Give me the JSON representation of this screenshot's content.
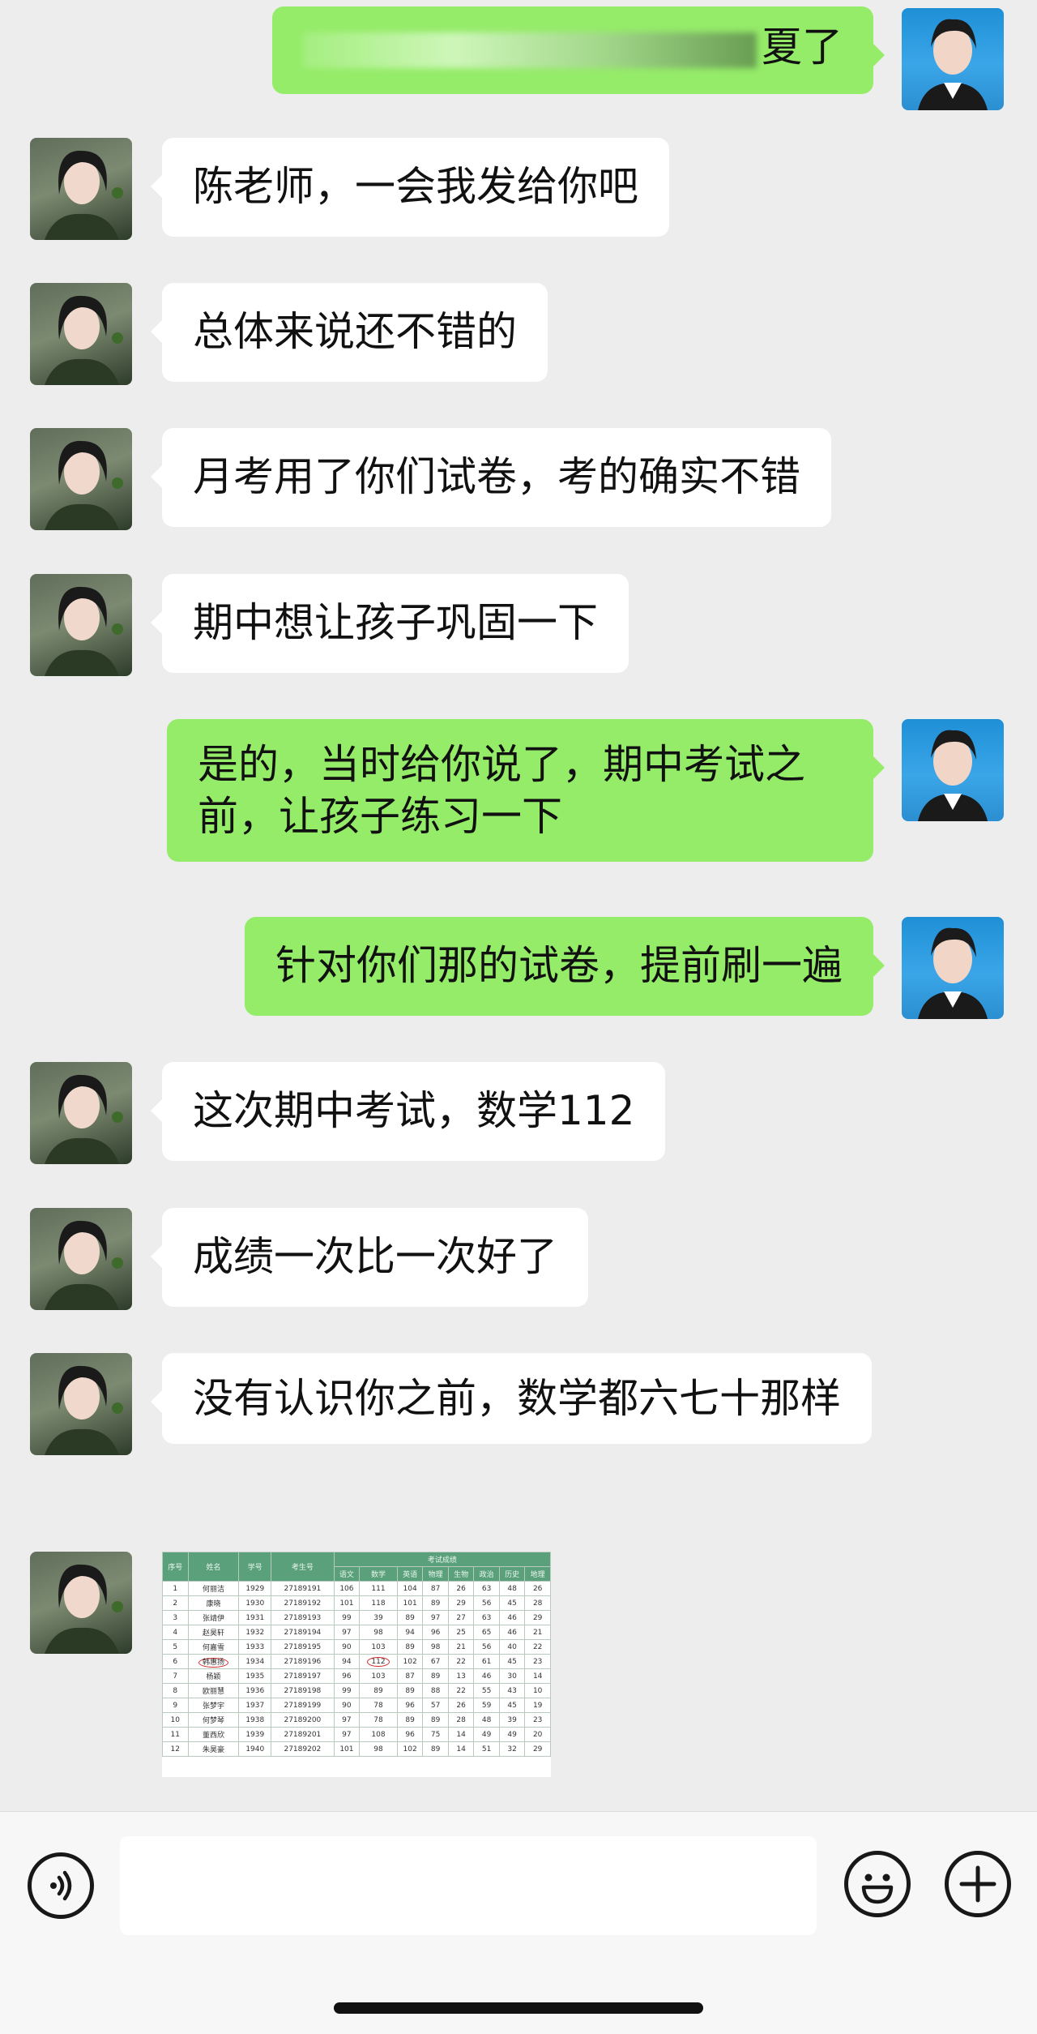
{
  "messages": [
    {
      "side": "out",
      "text": "夏了",
      "partial": true
    },
    {
      "side": "in",
      "text": "陈老师，一会我发给你吧"
    },
    {
      "side": "in",
      "text": "总体来说还不错的"
    },
    {
      "side": "in",
      "text": "月考用了你们试卷，考的确实不错"
    },
    {
      "side": "in",
      "text": "期中想让孩子巩固一下"
    },
    {
      "side": "out",
      "text": "是的，当时给你说了，期中考试之前，让孩子练习一下"
    },
    {
      "side": "out",
      "text": "针对你们那的试卷，提前刷一遍"
    },
    {
      "side": "in",
      "text": "这次期中考试，数学112"
    },
    {
      "side": "in",
      "text": "成绩一次比一次好了"
    },
    {
      "side": "in",
      "text": "没有认识你之前，数学都六七十那样"
    }
  ],
  "image_message": {
    "header": [
      "序号",
      "姓名",
      "学号",
      "考生号",
      "考试成绩"
    ],
    "subheader": [
      "语文",
      "数学",
      "英语",
      "物理",
      "生物",
      "政治",
      "历史",
      "地理"
    ],
    "rows": [
      [
        "1",
        "何丽洁",
        "1929",
        "27189191",
        "106",
        "111",
        "104",
        "87",
        "26",
        "63",
        "48",
        "26"
      ],
      [
        "2",
        "康晓",
        "1930",
        "27189192",
        "101",
        "118",
        "101",
        "89",
        "29",
        "56",
        "45",
        "28"
      ],
      [
        "3",
        "张靖伊",
        "1931",
        "27189193",
        "99",
        "39",
        "89",
        "97",
        "27",
        "63",
        "46",
        "29"
      ],
      [
        "4",
        "赵昊轩",
        "1932",
        "27189194",
        "97",
        "98",
        "94",
        "96",
        "25",
        "65",
        "46",
        "21"
      ],
      [
        "5",
        "何嘉雪",
        "1933",
        "27189195",
        "90",
        "103",
        "89",
        "98",
        "21",
        "56",
        "40",
        "22"
      ],
      [
        "6",
        "韩惠扬",
        "1934",
        "27189196",
        "94",
        "112",
        "102",
        "67",
        "22",
        "61",
        "45",
        "23"
      ],
      [
        "7",
        "杨颖",
        "1935",
        "27189197",
        "96",
        "103",
        "87",
        "89",
        "13",
        "46",
        "30",
        "14"
      ],
      [
        "8",
        "欧丽慧",
        "1936",
        "27189198",
        "99",
        "89",
        "89",
        "88",
        "22",
        "55",
        "43",
        "10"
      ],
      [
        "9",
        "张梦宇",
        "1937",
        "27189199",
        "90",
        "78",
        "96",
        "57",
        "26",
        "59",
        "45",
        "19"
      ],
      [
        "10",
        "何梦琴",
        "1938",
        "27189200",
        "97",
        "78",
        "89",
        "89",
        "28",
        "48",
        "39",
        "23"
      ],
      [
        "11",
        "董西欣",
        "1939",
        "27189201",
        "97",
        "108",
        "96",
        "75",
        "14",
        "49",
        "49",
        "20"
      ],
      [
        "12",
        "朱昊豪",
        "1940",
        "27189202",
        "101",
        "98",
        "102",
        "89",
        "14",
        "51",
        "32",
        "29"
      ]
    ]
  },
  "input": {
    "placeholder": ""
  }
}
